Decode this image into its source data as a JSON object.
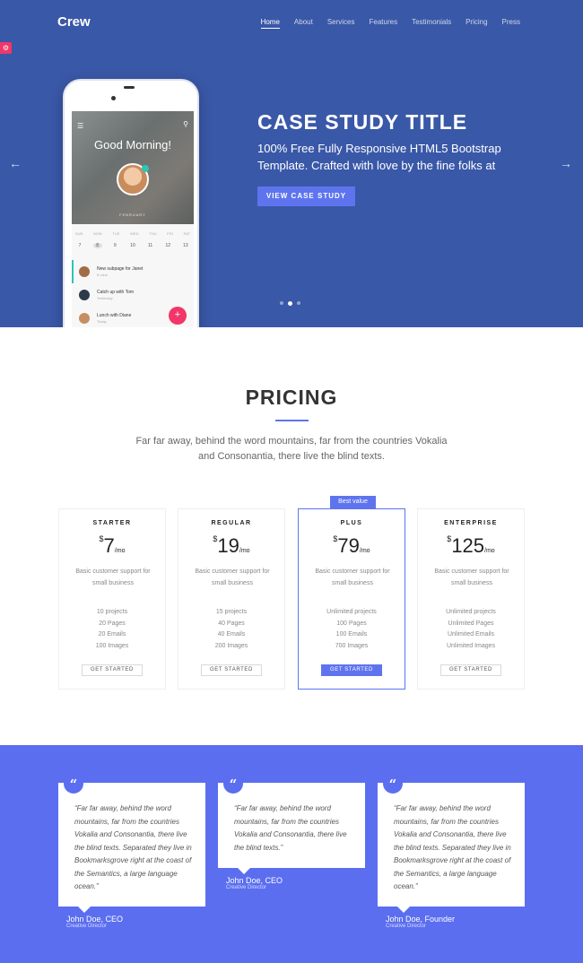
{
  "nav": {
    "brand": "Crew",
    "items": [
      "Home",
      "About",
      "Services",
      "Features",
      "Testimonials",
      "Pricing",
      "Press"
    ]
  },
  "hero": {
    "title": "CASE STUDY TITLE",
    "subtitle": "100% Free Fully Responsive HTML5 Bootstrap Template. Crafted with love by the fine folks at",
    "button": "VIEW CASE STUDY"
  },
  "phone": {
    "greeting": "Good Morning!",
    "month": "FEBRUARY",
    "days": [
      "SUN",
      "MON",
      "TUE",
      "WED",
      "THU",
      "FRI",
      "SAT"
    ],
    "dates": [
      "7",
      "8",
      "9",
      "10",
      "11",
      "12",
      "13"
    ],
    "feed": [
      {
        "text": "New subpage for Janet",
        "sub": "8 mins"
      },
      {
        "text": "Catch up with Tom",
        "sub": "Yesterday"
      },
      {
        "text": "Lunch with Diane",
        "sub": "Today"
      }
    ],
    "fab": "+"
  },
  "pricing": {
    "title": "PRICING",
    "lead": "Far far away, behind the word mountains, far from the countries Vokalia and Consonantia, there live the blind texts.",
    "badge": "Best value",
    "plans": [
      {
        "name": "STARTER",
        "currency": "$",
        "price": "7",
        "per": "/mo",
        "desc": "Basic customer support for small business",
        "features": [
          "10 projects",
          "20 Pages",
          "20 Emails",
          "100 Images"
        ],
        "button": "GET STARTED"
      },
      {
        "name": "REGULAR",
        "currency": "$",
        "price": "19",
        "per": "/mo",
        "desc": "Basic customer support for small business",
        "features": [
          "15 projects",
          "40 Pages",
          "40 Emails",
          "200 Images"
        ],
        "button": "GET STARTED"
      },
      {
        "name": "PLUS",
        "currency": "$",
        "price": "79",
        "per": "/mo",
        "desc": "Basic customer support for small business",
        "features": [
          "Unlimited projects",
          "100 Pages",
          "100 Emails",
          "700 Images"
        ],
        "button": "GET STARTED"
      },
      {
        "name": "ENTERPRISE",
        "currency": "$",
        "price": "125",
        "per": "/mo",
        "desc": "Basic customer support for small business",
        "features": [
          "Unlimited projects",
          "Unlimited Pages",
          "Unlimited Emails",
          "Unlimited Images"
        ],
        "button": "GET STARTED"
      }
    ]
  },
  "testimonials": [
    {
      "quote": "“Far far away, behind the word mountains, far from the countries Vokalia and Consonantia, there live the blind texts. Separated they live in Bookmarksgrove right at the coast of the Semantics, a large language ocean.”",
      "name": "John Doe, CEO",
      "role": "Creative Director"
    },
    {
      "quote": "“Far far away, behind the word mountains, far from the countries Vokalia and Consonantia, there live the blind texts.”",
      "name": "John Doe, CEO",
      "role": "Creative Director"
    },
    {
      "quote": "“Far far away, behind the word mountains, far from the countries Vokalia and Consonantia, there live the blind texts. Separated they live in Bookmarksgrove right at the coast of the Semantics, a large language ocean.”",
      "name": "John Doe, Founder",
      "role": "Creative Director"
    }
  ],
  "icons": {
    "quote": "“",
    "arrow_left": "←",
    "arrow_right": "→",
    "menu": "☰",
    "search": "⚲",
    "side_tab": "⚙"
  },
  "colors": {
    "hero_bg": "#3a58a8",
    "accent": "#5e74ef",
    "testimonial_bg": "#5b6ef0",
    "fab": "#f2366a"
  }
}
